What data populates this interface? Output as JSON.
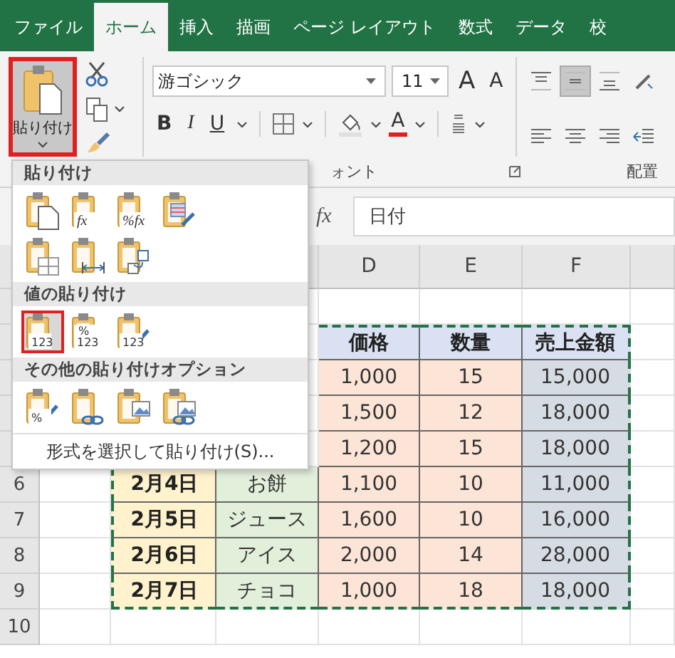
{
  "tabs": [
    {
      "label": "ファイル",
      "selected": false
    },
    {
      "label": "ホーム",
      "selected": true
    },
    {
      "label": "挿入",
      "selected": false
    },
    {
      "label": "描画",
      "selected": false
    },
    {
      "label": "ページ レイアウト",
      "selected": false
    },
    {
      "label": "数式",
      "selected": false
    },
    {
      "label": "データ",
      "selected": false
    },
    {
      "label": "校",
      "selected": false
    }
  ],
  "ribbon": {
    "paste_label": "貼り付け",
    "font_name": "游ゴシック",
    "font_size": "11",
    "grow_font": "A",
    "shrink_font": "A",
    "bold": "B",
    "italic": "I",
    "underline": "U",
    "font_color": "A",
    "alignment": [
      {
        "kind": "top",
        "selected": false
      },
      {
        "kind": "middle",
        "selected": true
      },
      {
        "kind": "bottom",
        "selected": false
      },
      {
        "kind": "orientation",
        "selected": false
      },
      {
        "kind": "left",
        "selected": false
      },
      {
        "kind": "center",
        "selected": false
      },
      {
        "kind": "right",
        "selected": false
      },
      {
        "kind": "indent",
        "selected": false
      }
    ],
    "group_labels": [
      "ォント",
      "配置"
    ]
  },
  "formula_bar": {
    "function_symbol": "fx",
    "value": "日付"
  },
  "sheet": {
    "columns": [
      "D",
      "E",
      "F"
    ],
    "rows": [
      {
        "cells": [
          {
            "kind": "header",
            "text": "価格"
          },
          {
            "kind": "header",
            "text": "数量"
          },
          {
            "kind": "header",
            "text": "売上金額"
          }
        ]
      },
      {
        "cells": [
          {
            "kind": "number",
            "text": "1,000"
          },
          {
            "kind": "number",
            "text": "15"
          },
          {
            "kind": "amount",
            "text": "15,000"
          }
        ]
      },
      {
        "cells": [
          {
            "kind": "number",
            "text": "1,500"
          },
          {
            "kind": "number",
            "text": "12"
          },
          {
            "kind": "amount",
            "text": "18,000"
          }
        ]
      },
      {
        "cells": [
          {
            "kind": "number",
            "text": "1,200"
          },
          {
            "kind": "number",
            "text": "15"
          },
          {
            "kind": "amount",
            "text": "18,000"
          }
        ]
      },
      {
        "number": "6",
        "cells": [
          {
            "kind": "date",
            "text": "2月4日"
          },
          {
            "kind": "item",
            "text": "お餅"
          },
          {
            "kind": "number",
            "text": "1,100"
          },
          {
            "kind": "number",
            "text": "10"
          },
          {
            "kind": "amount",
            "text": "11,000"
          }
        ]
      },
      {
        "number": "7",
        "cells": [
          {
            "kind": "date",
            "text": "2月5日"
          },
          {
            "kind": "item",
            "text": "ジュース"
          },
          {
            "kind": "number",
            "text": "1,600"
          },
          {
            "kind": "number",
            "text": "10"
          },
          {
            "kind": "amount",
            "text": "16,000"
          }
        ]
      },
      {
        "number": "8",
        "cells": [
          {
            "kind": "date",
            "text": "2月6日"
          },
          {
            "kind": "item",
            "text": "アイス"
          },
          {
            "kind": "number",
            "text": "2,000"
          },
          {
            "kind": "number",
            "text": "14"
          },
          {
            "kind": "amount",
            "text": "28,000"
          }
        ]
      },
      {
        "number": "9",
        "cells": [
          {
            "kind": "date",
            "text": "2月7日"
          },
          {
            "kind": "item",
            "text": "チョコ"
          },
          {
            "kind": "number",
            "text": "1,000"
          },
          {
            "kind": "number",
            "text": "18"
          },
          {
            "kind": "amount",
            "text": "18,000"
          }
        ]
      },
      {
        "number": "10"
      }
    ]
  },
  "paste_menu": {
    "sections": [
      {
        "title": "貼り付け",
        "items": [
          {
            "kind": "paste",
            "selected": false
          },
          {
            "kind": "glyph",
            "glyphs": [
              "fx"
            ],
            "selected": false
          },
          {
            "kind": "glyph",
            "glyphs": [
              "%fx"
            ],
            "selected": false
          },
          {
            "kind": "source-format",
            "selected": false
          },
          {
            "kind": "no-borders",
            "selected": false
          },
          {
            "kind": "column-widths",
            "selected": false
          },
          {
            "kind": "transpose",
            "selected": false
          }
        ]
      },
      {
        "title": "値の貼り付け",
        "items": [
          {
            "kind": "glyph",
            "glyphs": [
              "123"
            ],
            "selected": true
          },
          {
            "kind": "glyph",
            "glyphs": [
              "%",
              "123"
            ],
            "selected": false
          },
          {
            "kind": "brush-glyph",
            "glyphs": [
              "123"
            ],
            "selected": false
          }
        ]
      },
      {
        "title": "その他の貼り付けオプション",
        "items": [
          {
            "kind": "brush-glyph",
            "glyphs": [
              "%"
            ],
            "selected": false
          },
          {
            "kind": "link",
            "selected": false
          },
          {
            "kind": "picture",
            "selected": false
          },
          {
            "kind": "linked-picture",
            "selected": false
          }
        ]
      }
    ],
    "footer": "形式を選択して貼り付け(S)..."
  }
}
